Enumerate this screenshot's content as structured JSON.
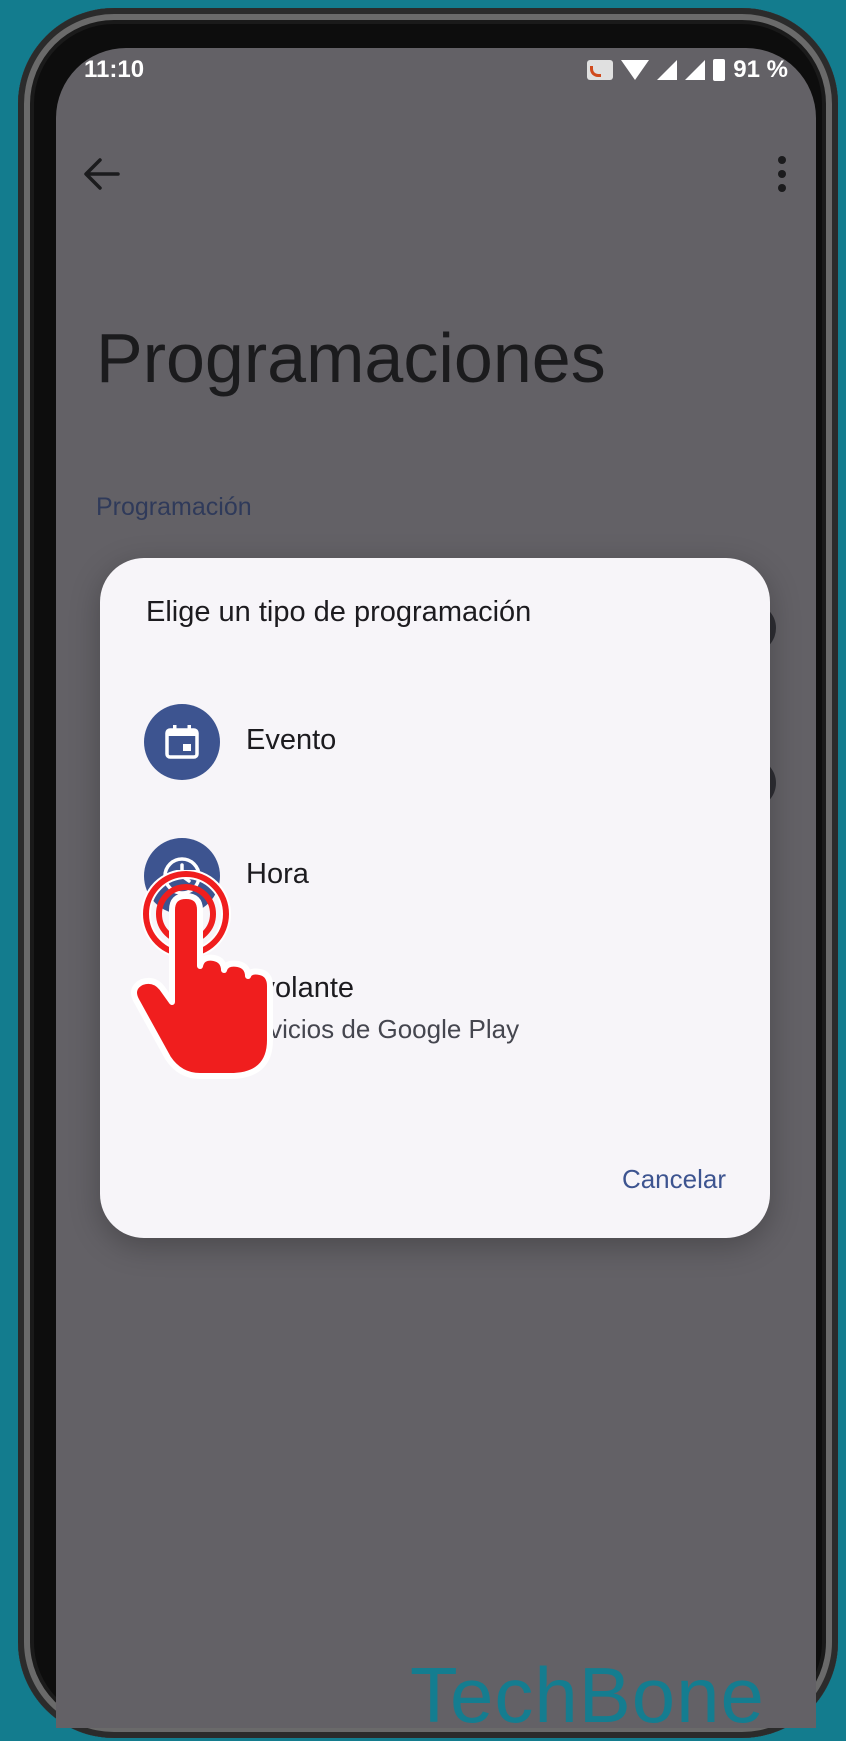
{
  "status_bar": {
    "time": "11:10",
    "battery": "91 %"
  },
  "page": {
    "title": "Programaciones",
    "section_header": "Programación"
  },
  "dialog": {
    "title": "Elige un tipo de programación",
    "options": [
      {
        "label": "Evento",
        "icon": "calendar-icon"
      },
      {
        "label": "Hora",
        "icon": "clock-icon"
      },
      {
        "label": "l volante",
        "sublabel": "ervicios de Google Play",
        "icon": "steering-wheel-icon"
      }
    ],
    "cancel_label": "Cancelar"
  },
  "watermark": "TechBone",
  "colors": {
    "background": "#137c8e",
    "scrim": "#636166",
    "dialog": "#f7f5f9",
    "accent": "#3d5490",
    "tap_hand": "#f01e1e"
  }
}
